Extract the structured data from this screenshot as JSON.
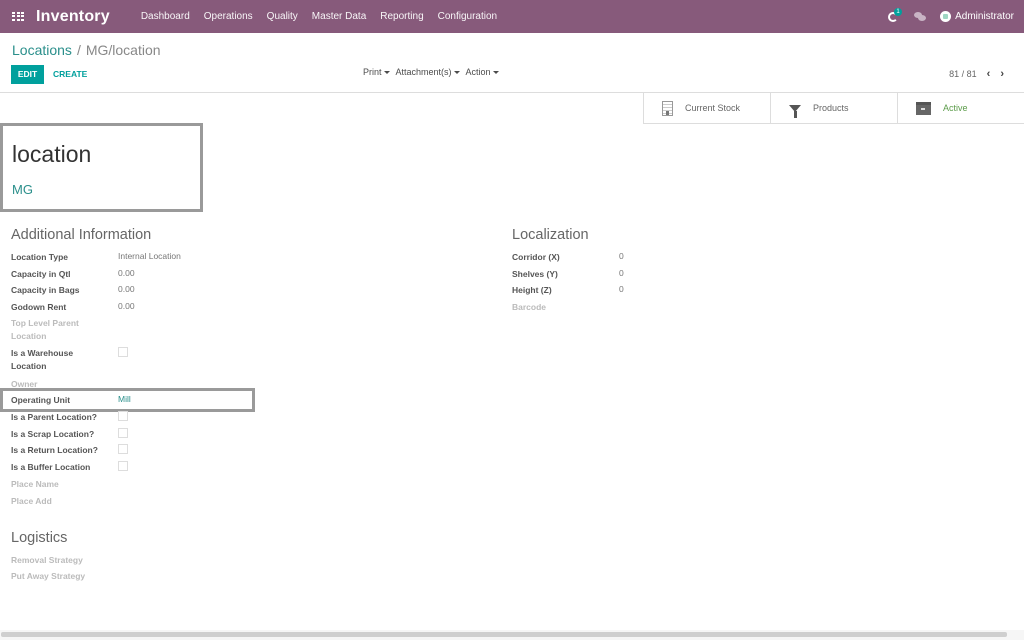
{
  "navbar": {
    "app_title": "Inventory",
    "menu": [
      "Dashboard",
      "Operations",
      "Quality",
      "Master Data",
      "Reporting",
      "Configuration"
    ],
    "activity_badge": "1",
    "user_name": "Administrator",
    "colors": {
      "brand": "#875a7b",
      "accent": "#00a09d"
    }
  },
  "breadcrumb": {
    "parent": "Locations",
    "separator": "/",
    "current": "MG/location"
  },
  "toolbar": {
    "edit_label": "EDIT",
    "create_label": "CREATE",
    "print_label": "Print",
    "attachments_label": "Attachment(s)",
    "action_label": "Action"
  },
  "pager": {
    "value": "81 / 81",
    "prev_icon": "chevron-left-icon",
    "next_icon": "chevron-right-icon"
  },
  "button_box": [
    {
      "label": "Current Stock",
      "icon": "building-icon"
    },
    {
      "label": "Products",
      "icon": "filter-icon"
    },
    {
      "label": "Active",
      "icon": "archive-icon"
    }
  ],
  "record": {
    "name": "location",
    "parent": "MG"
  },
  "additional_information": {
    "title": "Additional Information",
    "fields": {
      "location_type": {
        "label": "Location Type",
        "value": "Internal Location"
      },
      "capacity_qtl": {
        "label": "Capacity in Qtl",
        "value": "0.00"
      },
      "capacity_bags": {
        "label": "Capacity in Bags",
        "value": "0.00"
      },
      "godown_rent": {
        "label": "Godown Rent",
        "value": "0.00"
      },
      "top_level_parent": {
        "label": "Top Level Parent Location"
      },
      "is_warehouse": {
        "label": "Is a Warehouse Location",
        "checked": false
      },
      "owner": {
        "label": "Owner"
      },
      "operating_unit": {
        "label": "Operating Unit",
        "value": "Mill"
      },
      "is_parent": {
        "label": "Is a Parent Location?",
        "checked": false
      },
      "is_scrap": {
        "label": "Is a Scrap Location?",
        "checked": false
      },
      "is_return": {
        "label": "Is a Return Location?",
        "checked": false
      },
      "is_buffer": {
        "label": "Is a Buffer Location",
        "checked": false
      },
      "place_name": {
        "label": "Place Name"
      },
      "place_add": {
        "label": "Place Add"
      }
    }
  },
  "localization": {
    "title": "Localization",
    "fields": {
      "corridor": {
        "label": "Corridor (X)",
        "value": "0"
      },
      "shelves": {
        "label": "Shelves (Y)",
        "value": "0"
      },
      "height": {
        "label": "Height (Z)",
        "value": "0"
      },
      "barcode": {
        "label": "Barcode"
      }
    }
  },
  "logistics": {
    "title": "Logistics",
    "fields": {
      "removal_strategy": {
        "label": "Removal Strategy"
      },
      "put_away_strategy": {
        "label": "Put Away Strategy"
      }
    }
  }
}
